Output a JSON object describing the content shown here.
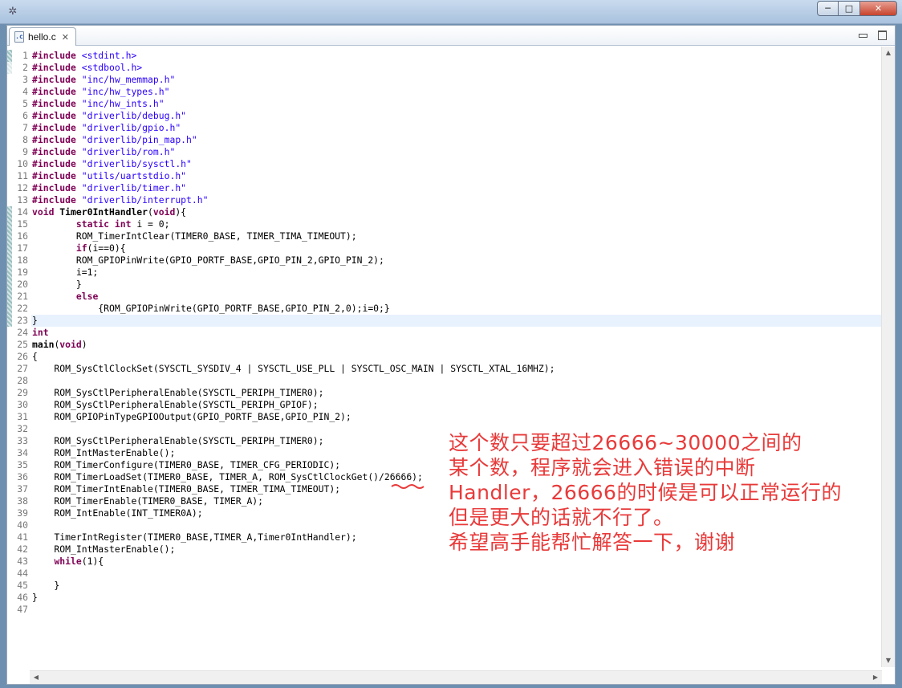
{
  "window": {
    "controls": {
      "minimize": "─",
      "maximize": "□",
      "close": "✕"
    }
  },
  "editor": {
    "tab": {
      "label": "hello.c",
      "icon": "c-file-icon",
      "close_glyph": "✕"
    },
    "highlight_color": "#e8f2fe"
  },
  "code_lines": [
    [
      [
        "kw",
        "#include"
      ],
      [
        "",
        "",
        " "
      ],
      [
        "str",
        "<stdint.h>"
      ]
    ],
    [
      [
        "kw",
        "#include"
      ],
      [
        "",
        " "
      ],
      [
        "str",
        "<stdbool.h>"
      ]
    ],
    [
      [
        "kw",
        "#include"
      ],
      [
        "",
        " "
      ],
      [
        "str",
        "\"inc/hw_memmap.h\""
      ]
    ],
    [
      [
        "kw",
        "#include"
      ],
      [
        "",
        " "
      ],
      [
        "str",
        "\"inc/hw_types.h\""
      ]
    ],
    [
      [
        "kw",
        "#include"
      ],
      [
        "",
        " "
      ],
      [
        "str",
        "\"inc/hw_ints.h\""
      ]
    ],
    [
      [
        "kw",
        "#include"
      ],
      [
        "",
        " "
      ],
      [
        "str",
        "\"driverlib/debug.h\""
      ]
    ],
    [
      [
        "kw",
        "#include"
      ],
      [
        "",
        " "
      ],
      [
        "str",
        "\"driverlib/gpio.h\""
      ]
    ],
    [
      [
        "kw",
        "#include"
      ],
      [
        "",
        " "
      ],
      [
        "str",
        "\"driverlib/pin_map.h\""
      ]
    ],
    [
      [
        "kw",
        "#include"
      ],
      [
        "",
        " "
      ],
      [
        "str",
        "\"driverlib/rom.h\""
      ]
    ],
    [
      [
        "kw",
        "#include"
      ],
      [
        "",
        " "
      ],
      [
        "str",
        "\"driverlib/sysctl.h\""
      ]
    ],
    [
      [
        "kw",
        "#include"
      ],
      [
        "",
        " "
      ],
      [
        "str",
        "\"utils/uartstdio.h\""
      ]
    ],
    [
      [
        "kw",
        "#include"
      ],
      [
        "",
        " "
      ],
      [
        "str",
        "\"driverlib/timer.h\""
      ]
    ],
    [
      [
        "kw",
        "#include"
      ],
      [
        "",
        " "
      ],
      [
        "str",
        "\"driverlib/interrupt.h\""
      ]
    ],
    [
      [
        "kw",
        "void"
      ],
      [
        "",
        " "
      ],
      [
        "fn",
        "Timer0IntHandler"
      ],
      [
        "",
        "("
      ],
      [
        "kw",
        "void"
      ],
      [
        "",
        "){"
      ]
    ],
    [
      [
        "",
        "        "
      ],
      [
        "kw",
        "static"
      ],
      [
        "",
        " "
      ],
      [
        "kw",
        "int"
      ],
      [
        "",
        " i = 0;"
      ]
    ],
    [
      [
        "",
        "        ROM_TimerIntClear(TIMER0_BASE, TIMER_TIMA_TIMEOUT);"
      ]
    ],
    [
      [
        "",
        "        "
      ],
      [
        "kw",
        "if"
      ],
      [
        "",
        "(i==0){"
      ]
    ],
    [
      [
        "",
        "        ROM_GPIOPinWrite(GPIO_PORTF_BASE,GPIO_PIN_2,GPIO_PIN_2);"
      ]
    ],
    [
      [
        "",
        "        i=1;"
      ]
    ],
    [
      [
        "",
        "        }"
      ]
    ],
    [
      [
        "",
        "        "
      ],
      [
        "kw",
        "else"
      ]
    ],
    [
      [
        "",
        "            {ROM_GPIOPinWrite(GPIO_PORTF_BASE,GPIO_PIN_2,0);i=0;}"
      ]
    ],
    [
      [
        "",
        "}"
      ]
    ],
    [
      [
        "kw",
        "int"
      ]
    ],
    [
      [
        "fn",
        "main"
      ],
      [
        "",
        "("
      ],
      [
        "kw",
        "void"
      ],
      [
        "",
        ")"
      ]
    ],
    [
      [
        "",
        "{"
      ]
    ],
    [
      [
        "",
        "    ROM_SysCtlClockSet(SYSCTL_SYSDIV_4 | SYSCTL_USE_PLL | SYSCTL_OSC_MAIN | SYSCTL_XTAL_16MHZ);"
      ]
    ],
    [
      [
        "",
        ""
      ]
    ],
    [
      [
        "",
        "    ROM_SysCtlPeripheralEnable(SYSCTL_PERIPH_TIMER0);"
      ]
    ],
    [
      [
        "",
        "    ROM_SysCtlPeripheralEnable(SYSCTL_PERIPH_GPIOF);"
      ]
    ],
    [
      [
        "",
        "    ROM_GPIOPinTypeGPIOOutput(GPIO_PORTF_BASE,GPIO_PIN_2);"
      ]
    ],
    [
      [
        "",
        ""
      ]
    ],
    [
      [
        "",
        "    ROM_SysCtlPeripheralEnable(SYSCTL_PERIPH_TIMER0);"
      ]
    ],
    [
      [
        "",
        "    ROM_IntMasterEnable();"
      ]
    ],
    [
      [
        "",
        "    ROM_TimerConfigure(TIMER0_BASE, TIMER_CFG_PERIODIC);"
      ]
    ],
    [
      [
        "",
        "    ROM_TimerLoadSet(TIMER0_BASE, TIMER_A, ROM_SysCtlClockGet()/26666);"
      ]
    ],
    [
      [
        "",
        "    ROM_TimerIntEnable(TIMER0_BASE, TIMER_TIMA_TIMEOUT);"
      ]
    ],
    [
      [
        "",
        "    ROM_TimerEnable(TIMER0_BASE, TIMER_A);"
      ]
    ],
    [
      [
        "",
        "    ROM_IntEnable(INT_TIMER0A);"
      ]
    ],
    [
      [
        "",
        ""
      ]
    ],
    [
      [
        "",
        "    "
      ],
      [
        "fn2",
        "TimerIntRegister"
      ],
      [
        "",
        "(TIMER0_BASE,TIMER_A,Timer0IntHandler);"
      ]
    ],
    [
      [
        "",
        "    ROM_IntMasterEnable();"
      ]
    ],
    [
      [
        "",
        "    "
      ],
      [
        "kw",
        "while"
      ],
      [
        "",
        "(1){"
      ]
    ],
    [
      [
        "",
        ""
      ]
    ],
    [
      [
        "",
        "    }"
      ]
    ],
    [
      [
        "",
        "}"
      ]
    ],
    [
      [
        "",
        ""
      ]
    ]
  ],
  "current_line": 23,
  "annotation": {
    "color": "#e83a3a",
    "lines": [
      "这个数只要超过26666~30000之间的",
      "某个数，程序就会进入错误的中断",
      "Handler，26666的时候是可以正常运行的",
      "但是更大的话就不行了。",
      "希望高手能帮忙解答一下，谢谢"
    ]
  }
}
